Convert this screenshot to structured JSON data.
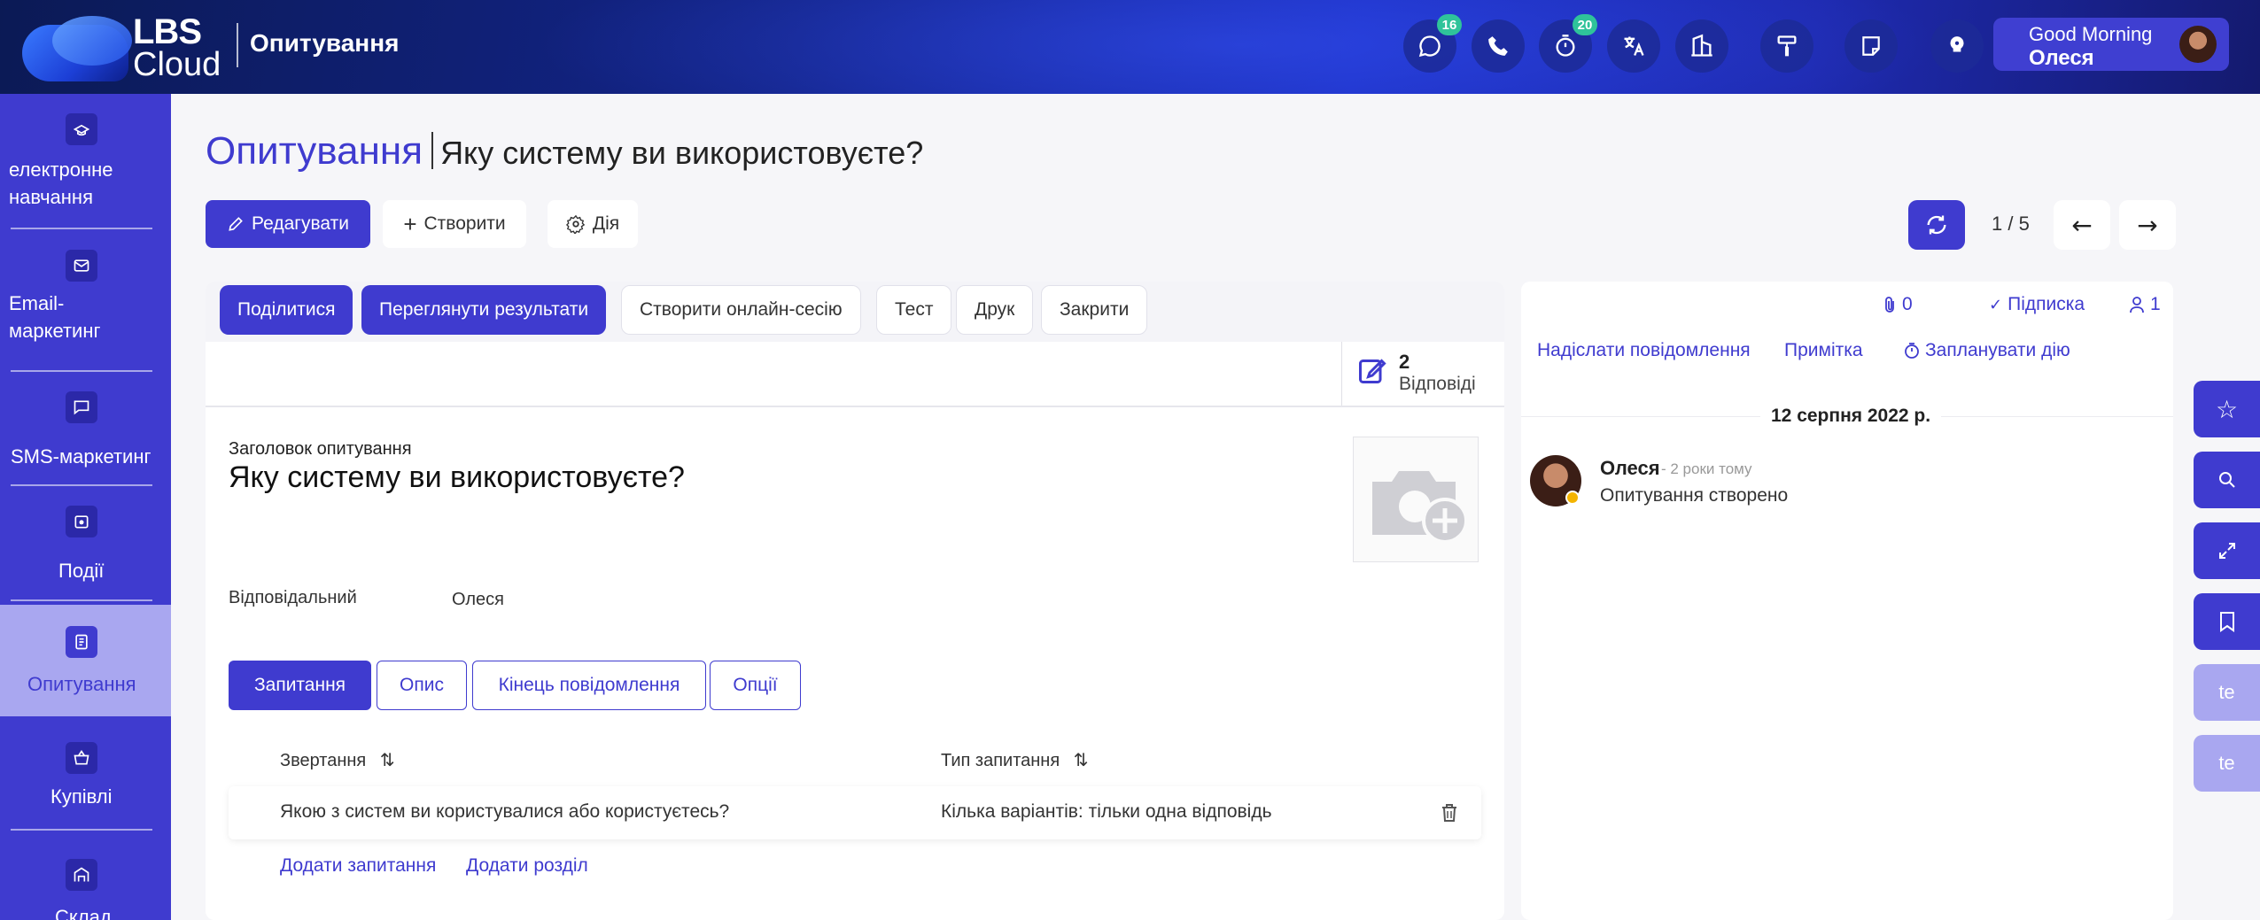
{
  "header": {
    "logo_text_top": "LBS",
    "logo_text_bottom": "Cloud",
    "app_title": "Опитування",
    "icons": [
      {
        "name": "chat-icon",
        "badge": "16"
      },
      {
        "name": "phone-icon",
        "badge": ""
      },
      {
        "name": "timer-icon",
        "badge": "20"
      },
      {
        "name": "translate-icon",
        "badge": ""
      },
      {
        "name": "building-icon",
        "badge": ""
      },
      {
        "name": "paint-roller-icon",
        "badge": ""
      },
      {
        "name": "note-icon",
        "badge": ""
      },
      {
        "name": "lightbulb-icon",
        "badge": ""
      }
    ],
    "greeting": "Good Morning",
    "user_name": "Олеся"
  },
  "sidebar": {
    "items": [
      {
        "label": "електронне навчання",
        "icon": "elearning-icon",
        "active": false
      },
      {
        "label": "Email-маркетинг",
        "icon": "email-marketing-icon",
        "active": false
      },
      {
        "label": "SMS-маркетинг",
        "icon": "sms-icon",
        "active": false
      },
      {
        "label": "Події",
        "icon": "events-icon",
        "active": false
      },
      {
        "label": "Опитування",
        "icon": "survey-icon",
        "active": true
      },
      {
        "label": "Купівлі",
        "icon": "basket-icon",
        "active": false
      },
      {
        "label": "Склад",
        "icon": "warehouse-icon",
        "active": false
      }
    ]
  },
  "page": {
    "breadcrumb_root": "Опитування",
    "breadcrumb_current": "Яку систему ви використовуєте?",
    "toolbar": {
      "edit_label": "Редагувати",
      "create_label": "Створити",
      "action_label": "Дія"
    },
    "pager": {
      "text": "1 / 5"
    }
  },
  "survey": {
    "header_buttons": {
      "share": "Поділитися",
      "view_results": "Переглянути результати",
      "create_session": "Створити онлайн-сесію",
      "test": "Тест",
      "print": "Друк",
      "close": "Закрити"
    },
    "answers_count": "2",
    "answers_label": "Відповіді",
    "title_label": "Заголовок опитування",
    "title": "Яку систему ви використовуєте?",
    "responsible_label": "Відповідальний",
    "responsible_value": "Олеся",
    "tabs": [
      "Запитання",
      "Опис",
      "Кінець повідомлення",
      "Опції"
    ],
    "table": {
      "columns": [
        "Звертання",
        "Тип запитання"
      ],
      "rows": [
        {
          "question": "Якою з систем ви користувалися або користуєтесь?",
          "type": "Кілька варіантів: тільки одна відповідь"
        }
      ],
      "add_question": "Додати запитання",
      "add_section": "Додати розділ"
    }
  },
  "chatter": {
    "attachments": "0",
    "follow_label": "Підписка",
    "followers": "1",
    "send_message": "Надіслати повідомлення",
    "log_note": "Примітка",
    "schedule_activity": "Запланувати дію",
    "date": "12 серпня 2022 р.",
    "messages": [
      {
        "author": "Олеся",
        "time": "- 2 роки тому",
        "body": "Опитування створено"
      }
    ]
  },
  "rail": {
    "buttons": [
      "star-icon",
      "search-icon",
      "expand-icon",
      "bookmark-icon"
    ],
    "text_buttons": [
      "te",
      "te"
    ]
  },
  "colors": {
    "primary": "#3f3bcf",
    "sidebar_active": "#a9a7f0",
    "badge": "#2fc39a",
    "status_dot": "#f4b400"
  }
}
